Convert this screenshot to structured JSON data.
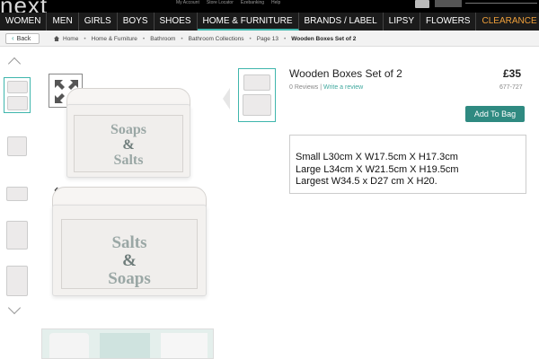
{
  "header": {
    "logo": "next",
    "top_links": [
      "My Account",
      "Store Locator",
      "Ezebanking",
      "Help"
    ]
  },
  "nav": {
    "items": [
      "WOMEN",
      "MEN",
      "GIRLS",
      "BOYS",
      "SHOES",
      "HOME & FURNITURE",
      "BRANDS / LABEL",
      "LIPSY",
      "FLOWERS",
      "CLEARANCE"
    ],
    "active": "HOME & FURNITURE"
  },
  "breadcrumb": {
    "back_label": "Back",
    "items": [
      "Home",
      "Home & Furniture",
      "Bathroom",
      "Bathroom Collections",
      "Page 13"
    ],
    "current": "Wooden Boxes Set of 2"
  },
  "product": {
    "title": "Wooden Boxes Set of 2",
    "price": "£35",
    "reviews": "0 Reviews",
    "review_link": "Write a review",
    "item_code": "677-727",
    "add_to_bag": "Add To Bag",
    "description_lines": [
      "Small L30cm X W17.5cm X H17.3cm",
      "Large L34cm X W21.5cm X H19.5cm",
      "Largest W34.5 x D27 cm X H20."
    ]
  },
  "image_text": {
    "box1_line1": "Soaps",
    "box1_line2": "&",
    "box1_line3": "Salts",
    "box2_line1": "Salts",
    "box2_line2": "&",
    "box2_line3": "Soaps"
  },
  "colors": {
    "accent": "#3fb6ac",
    "button": "#2f8a81",
    "clearance": "#f0a03a",
    "nav_bg": "#1b1b1b"
  }
}
